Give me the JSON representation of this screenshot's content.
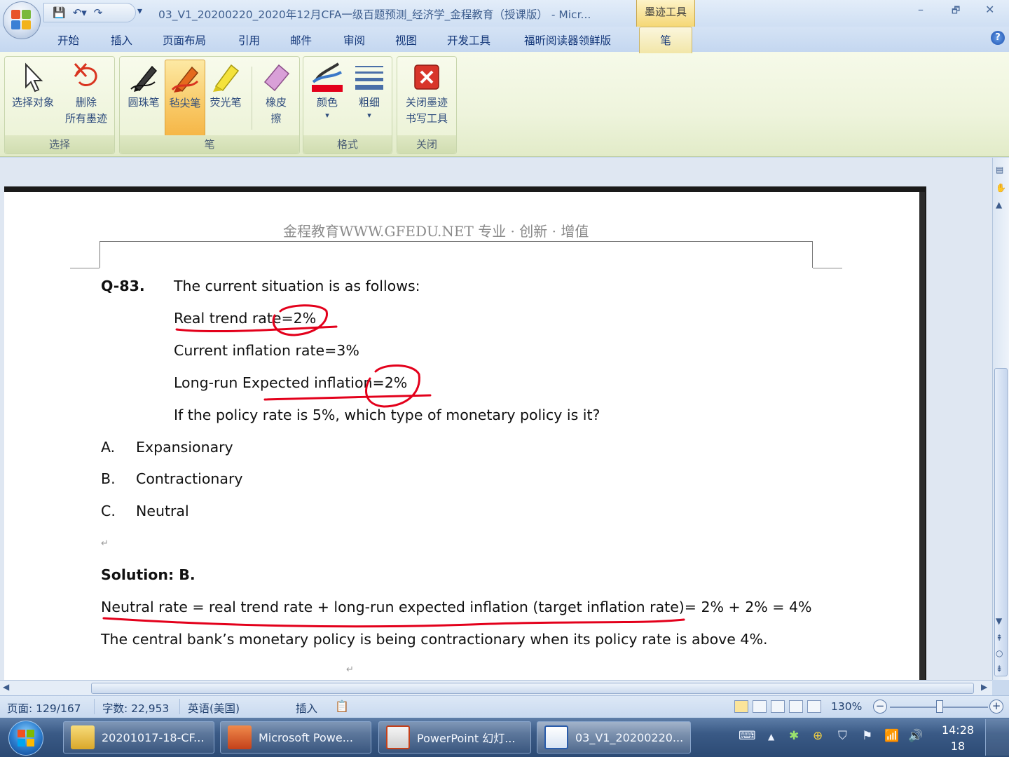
{
  "window": {
    "title": "03_V1_20200220_2020年12月CFA一级百题预测_经济学_金程教育（授课版） - Micr...",
    "contextual_tab_title": "墨迹工具",
    "minimize": "–",
    "restore": "🗗",
    "close": "✕"
  },
  "qat": {
    "more": "▾"
  },
  "tabs": [
    "开始",
    "插入",
    "页面布局",
    "引用",
    "邮件",
    "审阅",
    "视图",
    "开发工具",
    "福昕阅读器领鲜版"
  ],
  "active_tab": "笔",
  "help": "?",
  "ribbon": {
    "groups": {
      "select": "选择",
      "pen": "笔",
      "format": "格式",
      "close": "关闭"
    },
    "buttons": {
      "select_object": "选择对象",
      "delete_line1": "删除",
      "delete_line2": "所有墨迹",
      "ballpoint": "圆珠笔",
      "felt_tip": "毡尖笔",
      "highlighter": "荧光笔",
      "eraser_line1": "橡皮",
      "eraser_line2": "擦",
      "color": "颜色",
      "weight": "粗细",
      "close_line1": "关闭墨迹",
      "close_line2": "书写工具",
      "dropdown": "▾"
    },
    "accent_colors": {
      "ink_red": "#e3001b",
      "active_button": "#f8c966"
    }
  },
  "document": {
    "header": "金程教育WWW.GFEDU.NET      专业 · 创新 · 增值",
    "question_id": "Q-83.",
    "lines": [
      "The current situation is as follows:",
      "Real trend rate=2%",
      "Current inflation rate=3%",
      "Long-run Expected inflation=2%",
      "If the policy rate is 5%, which type of monetary policy is it?"
    ],
    "options": [
      {
        "letter": "A.",
        "text": "Expansionary"
      },
      {
        "letter": "B.",
        "text": "Contractionary"
      },
      {
        "letter": "C.",
        "text": "Neutral"
      }
    ],
    "solution": "Solution: B.",
    "explanation": [
      "Neutral rate = real trend rate + long-run expected inflation (target inflation rate)= 2% + 2% = 4%",
      "The central bank’s monetary policy is being contractionary when its policy rate is above 4%."
    ],
    "paragraph_mark": "↵"
  },
  "statusbar": {
    "page": "页面: 129/167",
    "words": "字数: 22,953",
    "language": "英语(美国)",
    "mode": "插入",
    "zoom": "130%",
    "zoom_minus": "−",
    "zoom_plus": "+"
  },
  "taskbar": {
    "items": [
      {
        "label": "20201017-18-CF...",
        "icon": "folder-icon"
      },
      {
        "label": "Microsoft Powe...",
        "icon": "powerpoint-icon"
      },
      {
        "label": "PowerPoint 幻灯...",
        "icon": "slideshow-icon"
      },
      {
        "label": "03_V1_20200220...",
        "icon": "word-icon"
      }
    ],
    "clock_time": "14:28",
    "clock_date": "18"
  }
}
